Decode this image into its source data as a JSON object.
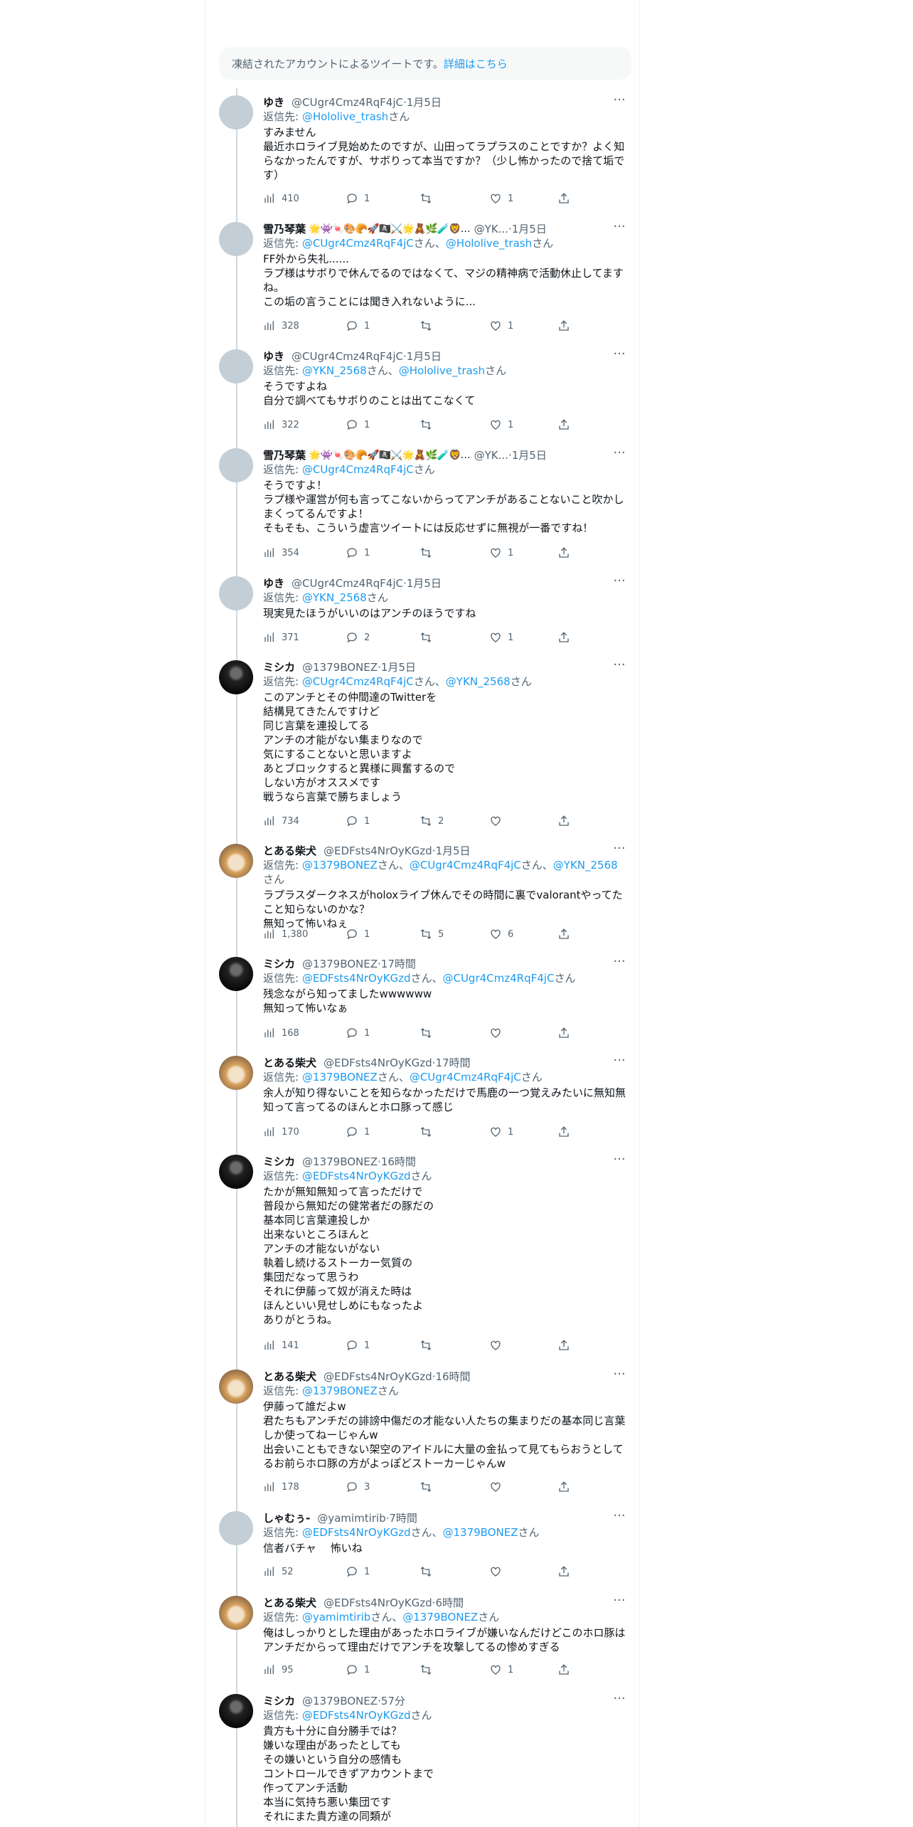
{
  "notice": {
    "text": "凍結されたアカウントによるツイートです。",
    "link": "詳細はこちら"
  },
  "reply_prefix": "返信先: ",
  "san": "さん",
  "tweets": [
    {
      "name": "ゆき",
      "handle": "@CUgr4Cmz4RqF4jC",
      "time": "1月5日",
      "reply_to": [
        "@Hololive_trash"
      ],
      "text": "すみません\n最近ホロライブ見始めたのですが、山田ってラプラスのことですか？よく知らなかったんですが、サボりって本当ですか？（少し怖かったので捨て垢です）",
      "views": "410",
      "replies": "1",
      "retweets": "",
      "likes": "1"
    },
    {
      "name": "雪乃琴葉",
      "emoji": "🌟👾🍬🎨🥐🚀🏴‍☠️⚔️🌟🧸🌿🧪🦁…",
      "handle": "@YK...",
      "time": "1月5日",
      "reply_to": [
        "@CUgr4Cmz4RqF4jC",
        "@Hololive_trash"
      ],
      "text": "FF外から失礼......\nラプ様はサボりで休んでるのではなくて、マジの精神病で活動休止してますね。\nこの垢の言うことには聞き入れないように...",
      "views": "328",
      "replies": "1",
      "retweets": "",
      "likes": "1"
    },
    {
      "name": "ゆき",
      "handle": "@CUgr4Cmz4RqF4jC",
      "time": "1月5日",
      "reply_to": [
        "@YKN_2568",
        "@Hololive_trash"
      ],
      "text": "そうですよね\n自分で調べてもサボりのことは出てこなくて",
      "views": "322",
      "replies": "1",
      "retweets": "",
      "likes": "1"
    },
    {
      "name": "雪乃琴葉",
      "emoji": "🌟👾🍬🎨🥐🚀🏴‍☠️⚔️🌟🧸🌿🧪🦁…",
      "handle": "@YK...",
      "time": "1月5日",
      "reply_to": [
        "@CUgr4Cmz4RqF4jC"
      ],
      "text": "そうですよ！\nラプ様や運営が何も言ってこないからってアンチがあることないこと吹かしまくってるんですよ！\nそもそも、こういう虚言ツイートには反応せずに無視が一番ですね！",
      "views": "354",
      "replies": "1",
      "retweets": "",
      "likes": "1"
    },
    {
      "name": "ゆき",
      "handle": "@CUgr4Cmz4RqF4jC",
      "time": "1月5日",
      "reply_to": [
        "@YKN_2568"
      ],
      "text": "現実見たほうがいいのはアンチのほうですね",
      "views": "371",
      "replies": "2",
      "retweets": "",
      "likes": "1"
    },
    {
      "name": "ミシカ",
      "handle": "@1379BONEZ",
      "time": "1月5日",
      "reply_to": [
        "@CUgr4Cmz4RqF4jC",
        "@YKN_2568"
      ],
      "text": "このアンチとその仲間達のTwitterを\n結構見てきたんですけど\n同じ言葉を連投してる\nアンチの才能がない集まりなので\n気にすることないと思いますよ\nあとブロックすると異様に興奮するので\nしない方がオススメです\n戦うなら言葉で勝ちましょう",
      "views": "734",
      "replies": "1",
      "retweets": "2",
      "likes": ""
    },
    {
      "name": "とある柴犬",
      "handle": "@EDFsts4NrOyKGzd",
      "time": "1月5日",
      "reply_to": [
        "@1379BONEZ",
        "@CUgr4Cmz4RqF4jC",
        "@YKN_2568"
      ],
      "text": "ラプラスダークネスがholoxライブ休んでその時間に裏でvalorantやってたこと知らないのかな？\n無知って怖いねぇ",
      "views": "1,380",
      "replies": "1",
      "retweets": "5",
      "likes": "6"
    },
    {
      "name": "ミシカ",
      "handle": "@1379BONEZ",
      "time": "17時間",
      "reply_to": [
        "@EDFsts4NrOyKGzd",
        "@CUgr4Cmz4RqF4jC"
      ],
      "text": "残念ながら知ってましたwwwwww\n無知って怖いなぁ",
      "views": "168",
      "replies": "1",
      "retweets": "",
      "likes": ""
    },
    {
      "name": "とある柴犬",
      "handle": "@EDFsts4NrOyKGzd",
      "time": "17時間",
      "reply_to": [
        "@1379BONEZ",
        "@CUgr4Cmz4RqF4jC"
      ],
      "text": "余人が知り得ないことを知らなかっただけで馬鹿の一つ覚えみたいに無知無知って言ってるのほんとホロ豚って感じ",
      "views": "170",
      "replies": "1",
      "retweets": "",
      "likes": "1"
    },
    {
      "name": "ミシカ",
      "handle": "@1379BONEZ",
      "time": "16時間",
      "reply_to": [
        "@EDFsts4NrOyKGzd"
      ],
      "text": "たかが無知無知って言っただけで\n普段から無知だの健常者だの豚だの\n基本同じ言葉連投しか\n出来ないところほんと\nアンチの才能ないがない\n執着し続けるストーカー気質の\n集団だなって思うわ\nそれに伊藤って奴が消えた時は\nほんといい見せしめにもなったよ\nありがとうね。",
      "views": "141",
      "replies": "1",
      "retweets": "",
      "likes": ""
    },
    {
      "name": "とある柴犬",
      "handle": "@EDFsts4NrOyKGzd",
      "time": "16時間",
      "reply_to": [
        "@1379BONEZ"
      ],
      "text": "伊藤って誰だよw\n君たちもアンチだの誹謗中傷だの才能ない人たちの集まりだの基本同じ言葉しか使ってねーじゃんw\n出会いこともできない架空のアイドルに大量の金払って見てもらおうとしてるお前らホロ豚の方がよっぽどストーカーじゃんw",
      "views": "178",
      "replies": "3",
      "retweets": "",
      "likes": ""
    },
    {
      "name": "しゃむぅ-",
      "handle": "@yamimtirib",
      "time": "7時間",
      "reply_to": [
        "@EDFsts4NrOyKGzd",
        "@1379BONEZ"
      ],
      "text": "信者バチャ　 怖いね",
      "views": "52",
      "replies": "1",
      "retweets": "",
      "likes": ""
    },
    {
      "name": "とある柴犬",
      "handle": "@EDFsts4NrOyKGzd",
      "time": "6時間",
      "reply_to": [
        "@yamimtirib",
        "@1379BONEZ"
      ],
      "text": "俺はしっかりとした理由があったホロライブが嫌いなんだけどこのホロ豚はアンチだからって理由だけでアンチを攻撃してるの惨めすぎる",
      "views": "95",
      "replies": "1",
      "retweets": "",
      "likes": "1"
    },
    {
      "name": "ミシカ",
      "handle": "@1379BONEZ",
      "time": "57分",
      "reply_to": [
        "@EDFsts4NrOyKGzd"
      ],
      "text": "貴方も十分に自分勝手では？\n嫌いな理由があったとしても\nその嫌いという自分の感情も\nコントロールできずアカウントまで\n作ってアンチ活動\n本当に気持ち悪い集団です\nそれにまた貴方達の同類が",
      "views": "",
      "replies": "",
      "retweets": "",
      "likes": ""
    }
  ],
  "colors": {
    "accent": "#1d9bf0",
    "muted": "#536471",
    "line": "#cfd9de",
    "notice_bg": "#f7f9f9"
  },
  "icons": {
    "views": "bar-chart-icon",
    "reply": "speech-bubble-icon",
    "retweet": "retweet-arrows-icon",
    "like": "heart-icon",
    "share": "share-upload-icon",
    "more": "ellipsis-icon"
  }
}
